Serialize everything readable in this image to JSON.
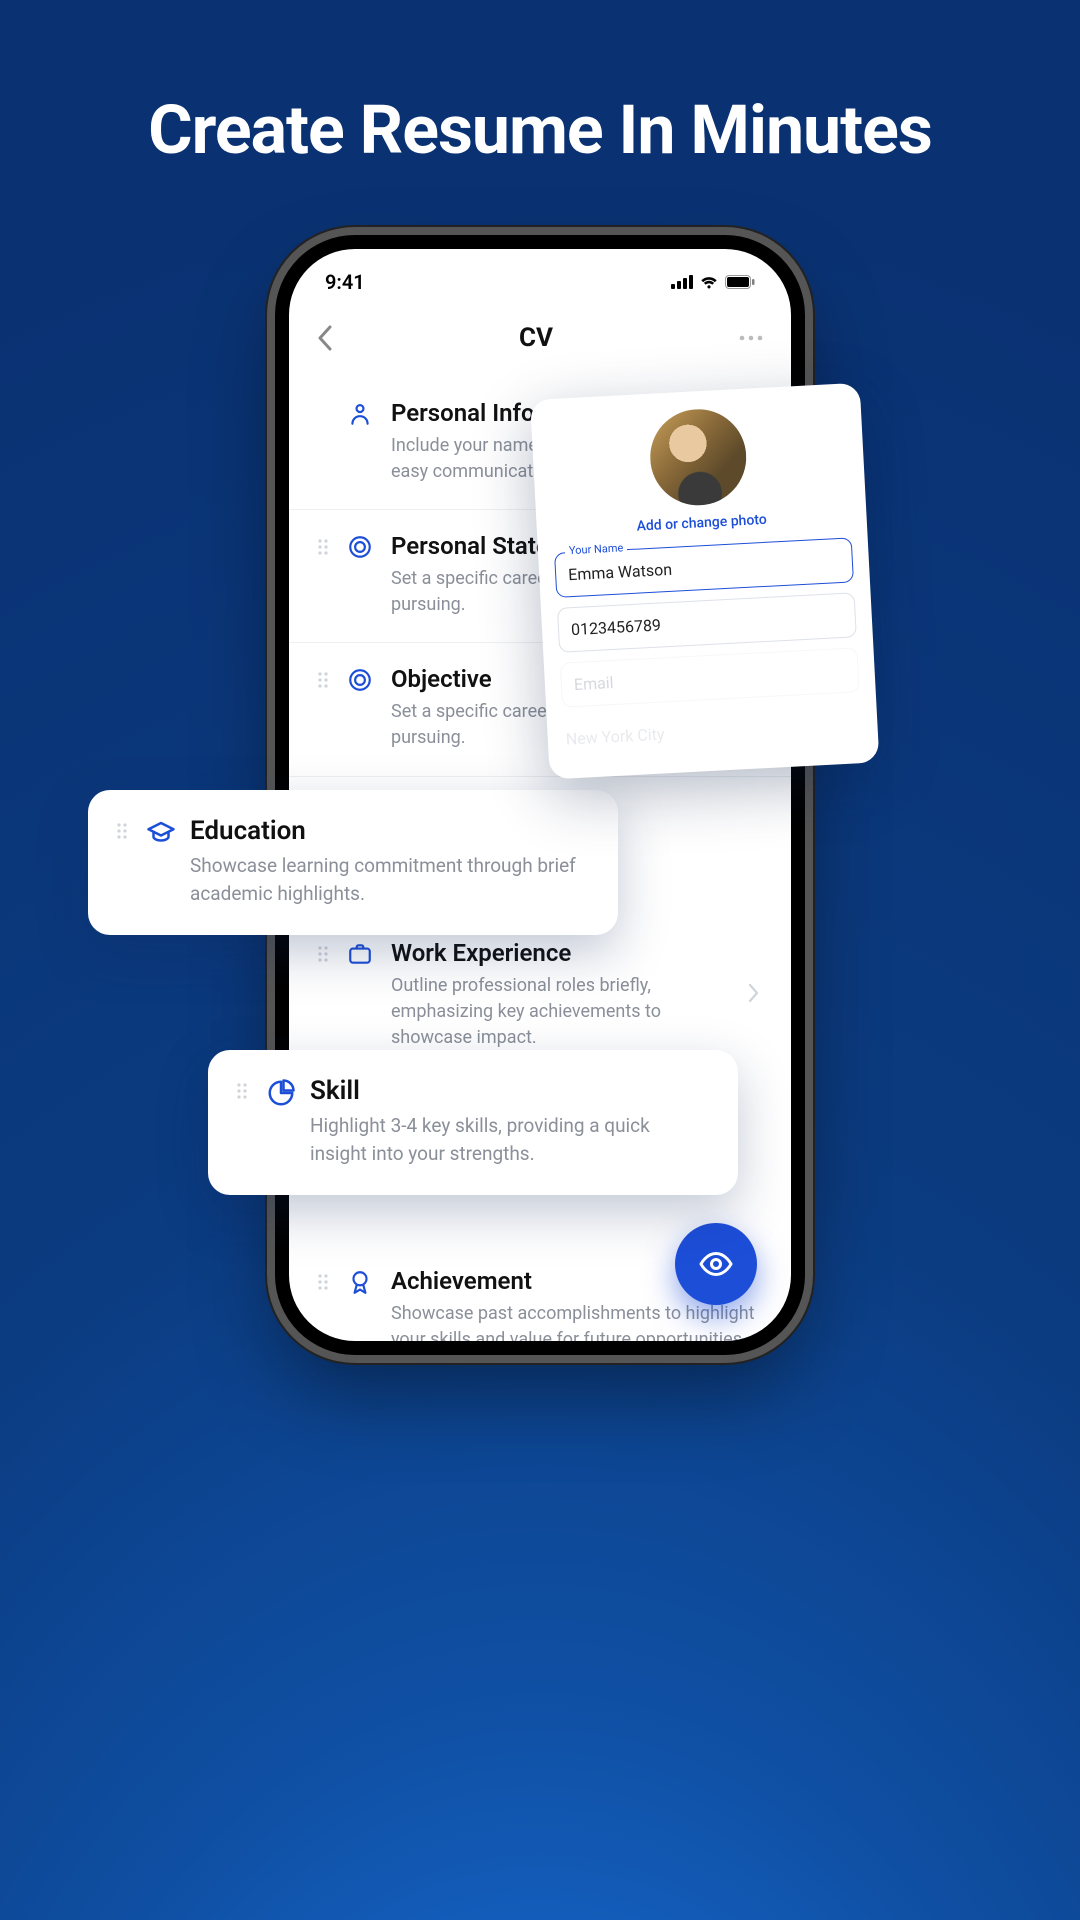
{
  "headline": "Create Resume In Minutes",
  "statusbar": {
    "time": "9:41"
  },
  "nav": {
    "title": "CV"
  },
  "sections": {
    "personal_info": {
      "title": "Personal Information",
      "desc": "Include your name, email, phone number for easy communication."
    },
    "statement": {
      "title": "Personal Statement",
      "desc": "Set a specific career goal you are actively pursuing."
    },
    "objective": {
      "title": "Objective",
      "desc": "Set a specific career goal you are actively pursuing."
    },
    "education": {
      "title": "Education",
      "desc": "Showcase learning commitment through brief academic highlights."
    },
    "work": {
      "title": "Work Experience",
      "desc": "Outline professional roles briefly, emphasizing key achievements to showcase impact."
    },
    "skill": {
      "title": "Skill",
      "desc": "Highlight 3-4 key skills, providing a quick insight into your strengths."
    },
    "achievement": {
      "title": "Achievement",
      "desc": "Showcase past accomplishments to highlight your skills and value for future opportunities."
    }
  },
  "popup": {
    "photo_link": "Add or change photo",
    "name_label": "Your Name",
    "name_value": "Emma Watson",
    "phone_value": "0123456789",
    "email_placeholder": "Email",
    "city_value": "New York City"
  }
}
